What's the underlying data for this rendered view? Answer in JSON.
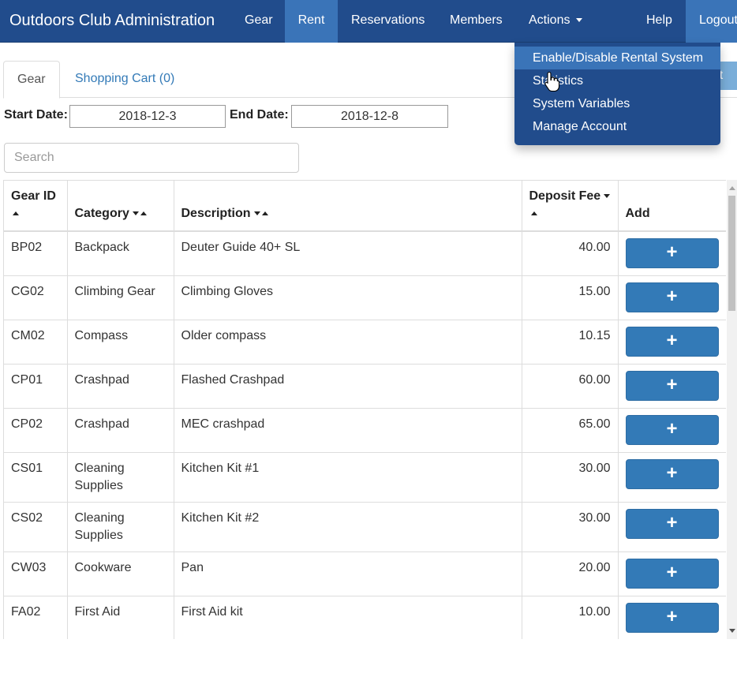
{
  "navbar": {
    "brand": "Outdoors Club Administration",
    "items": [
      {
        "label": "Gear",
        "active": false
      },
      {
        "label": "Rent",
        "active": true
      },
      {
        "label": "Reservations",
        "active": false
      },
      {
        "label": "Members",
        "active": false
      },
      {
        "label": "Actions",
        "active": false
      },
      {
        "label": "Help",
        "active": false
      },
      {
        "label": "Logout",
        "active": false
      }
    ]
  },
  "actions_menu": {
    "items": [
      "Enable/Disable Rental System",
      "Statistics",
      "System Variables",
      "Manage Account"
    ]
  },
  "tabs": {
    "gear": "Gear",
    "cart": "Shopping Cart (0)",
    "checkout_partial": "out"
  },
  "dates": {
    "start_label": "Start Date:",
    "start_value": "2018-12-3",
    "end_label": "End Date:",
    "end_value": "2018-12-8"
  },
  "search": {
    "placeholder": "Search"
  },
  "table": {
    "headers": {
      "gear_id": "Gear ID",
      "category": "Category",
      "description": "Description",
      "deposit_fee": "Deposit Fee",
      "add": "Add"
    },
    "add_symbol": "+",
    "rows": [
      {
        "id": "BP02",
        "category": "Backpack",
        "description": "Deuter Guide 40+ SL",
        "fee": "40.00"
      },
      {
        "id": "CG02",
        "category": "Climbing Gear",
        "description": "Climbing Gloves",
        "fee": "15.00"
      },
      {
        "id": "CM02",
        "category": "Compass",
        "description": "Older compass",
        "fee": "10.15"
      },
      {
        "id": "CP01",
        "category": "Crashpad",
        "description": "Flashed Crashpad",
        "fee": "60.00"
      },
      {
        "id": "CP02",
        "category": "Crashpad",
        "description": "MEC crashpad",
        "fee": "65.00"
      },
      {
        "id": "CS01",
        "category": "Cleaning Supplies",
        "description": "Kitchen Kit #1",
        "fee": "30.00"
      },
      {
        "id": "CS02",
        "category": "Cleaning Supplies",
        "description": "Kitchen Kit #2",
        "fee": "30.00"
      },
      {
        "id": "CW03",
        "category": "Cookware",
        "description": "Pan",
        "fee": "20.00"
      },
      {
        "id": "FA02",
        "category": "First Aid",
        "description": "First Aid kit",
        "fee": "10.00"
      }
    ]
  },
  "colors": {
    "navbar": "#214c8c",
    "active": "#3a74b8",
    "primary_button": "#337ab7",
    "link": "#337ab7"
  }
}
